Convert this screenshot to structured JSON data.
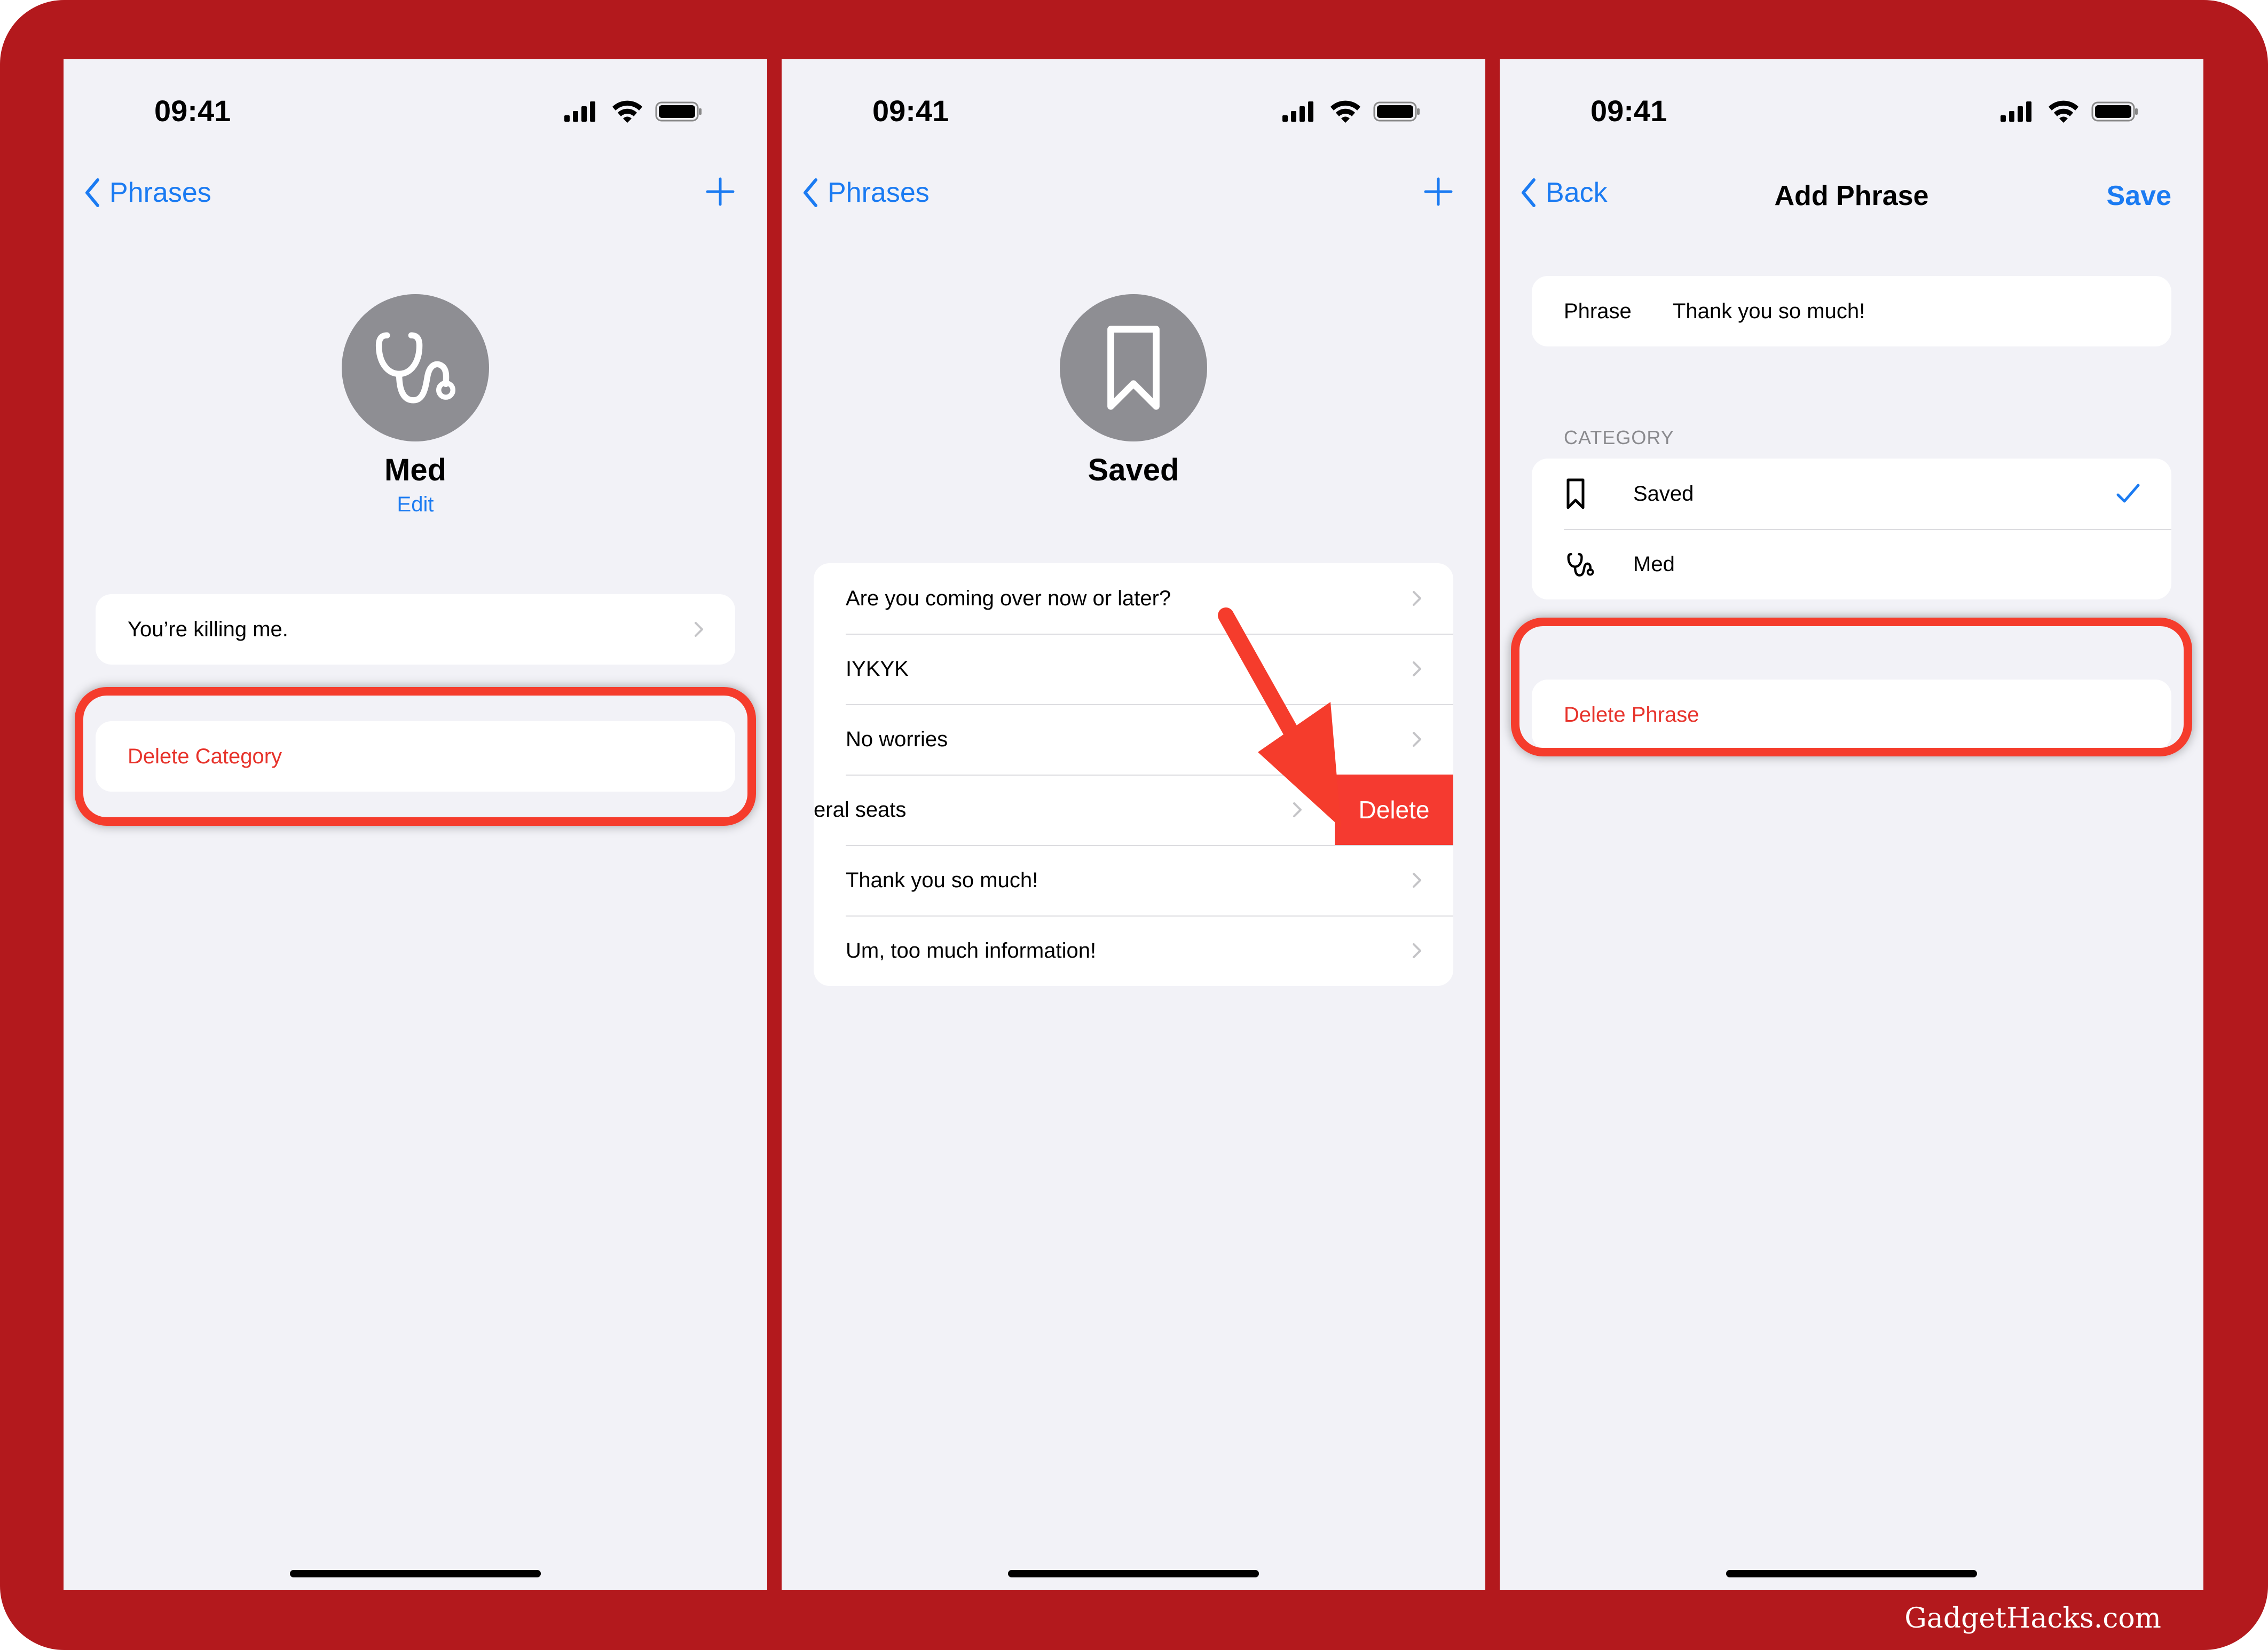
{
  "status_time": "09:41",
  "screen1": {
    "back_label": "Phrases",
    "category_name": "Med",
    "edit_label": "Edit",
    "phrases": [
      "You’re killing me."
    ],
    "delete_label": "Delete Category"
  },
  "screen2": {
    "back_label": "Phrases",
    "category_name": "Saved",
    "phrases": [
      "Are you coming over now or later?",
      "IYKYK",
      "No worries",
      "eral seats",
      "Thank you so much!",
      "Um, too much information!"
    ],
    "delete_action": "Delete"
  },
  "screen3": {
    "back_label": "Back",
    "title": "Add Phrase",
    "save_label": "Save",
    "phrase_field_label": "Phrase",
    "phrase_value": "Thank you so much!",
    "category_header": "CATEGORY",
    "categories": [
      {
        "name": "Saved",
        "icon": "bookmark-icon",
        "selected": true
      },
      {
        "name": "Med",
        "icon": "stethoscope-icon",
        "selected": false
      }
    ],
    "delete_label": "Delete Phrase"
  },
  "watermark": "GadgetHacks.com",
  "colors": {
    "accent": "#1b7bf2",
    "destructive": "#e7332b",
    "frame": "#b3191d",
    "annotation": "#f53c2c"
  }
}
